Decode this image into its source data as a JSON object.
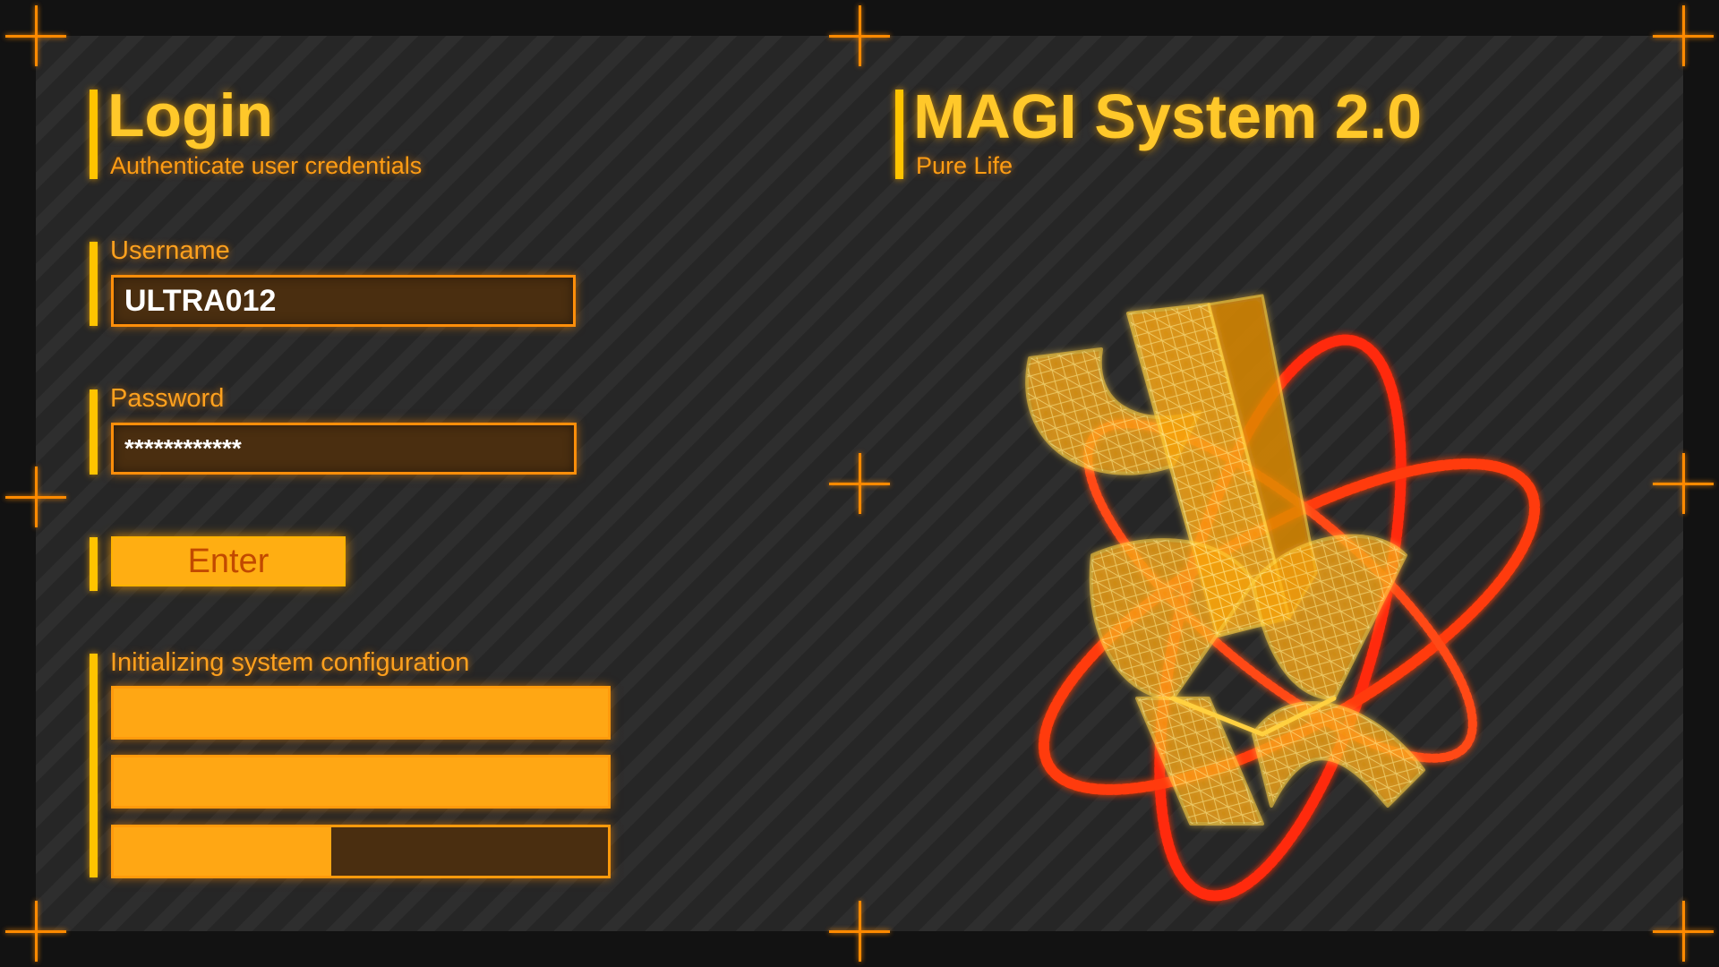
{
  "login": {
    "title": "Login",
    "subtitle": "Authenticate user credentials"
  },
  "username": {
    "label": "Username",
    "value": "ULTRA012"
  },
  "password": {
    "label": "Password",
    "value": "************"
  },
  "enter_label": "Enter",
  "status": {
    "label": "Initializing system configuration",
    "progress": [
      1.0,
      1.0,
      0.44
    ]
  },
  "system": {
    "title": "MAGI System 2.0",
    "subtitle": "Pure Life"
  },
  "emblem": {
    "icon": "magi-wireframe-emblem-icon"
  },
  "colors": {
    "accent": "#ffa714",
    "title": "#ffc82a",
    "ring": "#ff2a10",
    "background": "#262626"
  }
}
